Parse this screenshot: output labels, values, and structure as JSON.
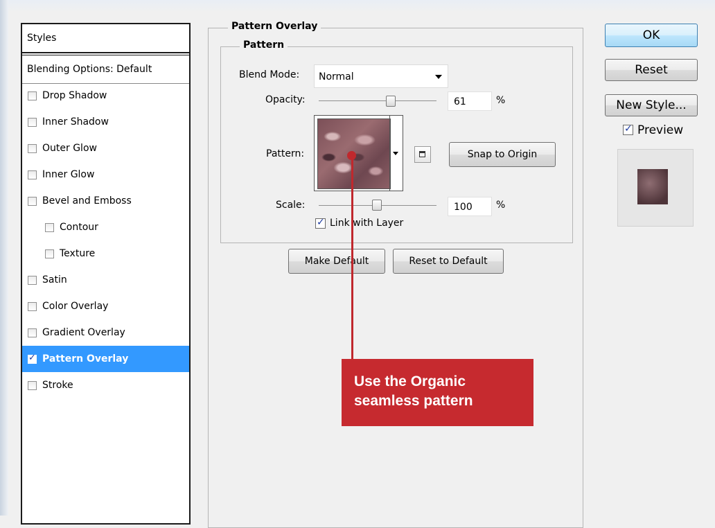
{
  "styles_panel": {
    "header": "Styles",
    "blending_options": "Blending Options: Default",
    "items": [
      {
        "label": "Drop Shadow",
        "checked": false
      },
      {
        "label": "Inner Shadow",
        "checked": false
      },
      {
        "label": "Outer Glow",
        "checked": false
      },
      {
        "label": "Inner Glow",
        "checked": false
      },
      {
        "label": "Bevel and Emboss",
        "checked": false
      },
      {
        "label": "Contour",
        "checked": false
      },
      {
        "label": "Texture",
        "checked": false
      },
      {
        "label": "Satin",
        "checked": false
      },
      {
        "label": "Color Overlay",
        "checked": false
      },
      {
        "label": "Gradient Overlay",
        "checked": false
      },
      {
        "label": "Pattern Overlay",
        "checked": true,
        "selected": true
      },
      {
        "label": "Stroke",
        "checked": false
      }
    ]
  },
  "pattern_overlay": {
    "title": "Pattern Overlay",
    "subgroup_title": "Pattern",
    "blend_mode_label": "Blend Mode:",
    "blend_mode_value": "Normal",
    "opacity_label": "Opacity:",
    "opacity_value": "61",
    "opacity_unit": "%",
    "pattern_label": "Pattern:",
    "pattern_icon": "organic-pattern-swatch",
    "snap_button": "Snap to Origin",
    "scale_label": "Scale:",
    "scale_value": "100",
    "scale_unit": "%",
    "link_label": "Link with Layer",
    "link_checked": true,
    "make_default_button": "Make Default",
    "reset_default_button": "Reset to Default"
  },
  "actions": {
    "ok": "OK",
    "reset": "Reset",
    "new_style": "New Style...",
    "preview_label": "Preview",
    "preview_checked": true
  },
  "annotation": {
    "text": "Use the Organic\nseamless pattern",
    "color": "#c62a2f"
  }
}
